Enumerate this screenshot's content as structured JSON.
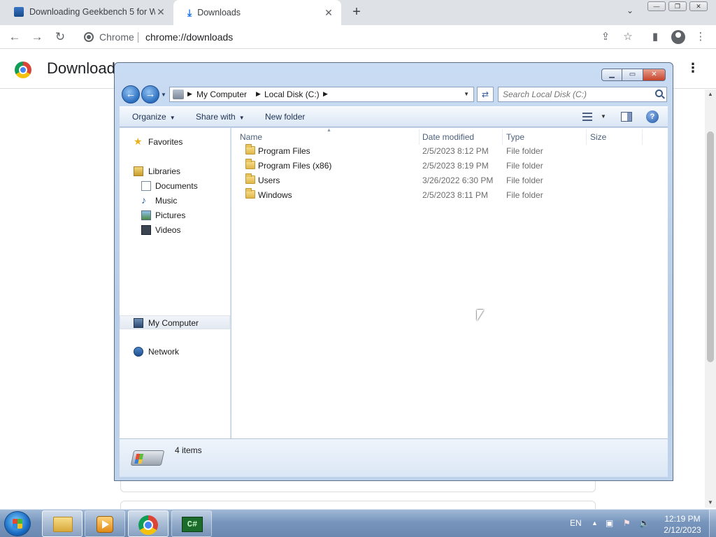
{
  "chrome": {
    "tabs": [
      {
        "title": "Downloading Geekbench 5 for W",
        "close": "✕"
      },
      {
        "title": "Downloads",
        "close": "✕"
      }
    ],
    "new_tab": "+",
    "omnibox": {
      "label": "Chrome",
      "url": "chrome://downloads"
    },
    "page_title": "Download"
  },
  "explorer": {
    "breadcrumbs": [
      "My Computer",
      "Local Disk (C:)"
    ],
    "search_placeholder": "Search Local Disk (C:)",
    "commands": {
      "organize": "Organize",
      "share_with": "Share with",
      "new_folder": "New folder"
    },
    "nav": {
      "favorites": "Favorites",
      "libraries": "Libraries",
      "documents": "Documents",
      "music": "Music",
      "pictures": "Pictures",
      "videos": "Videos",
      "my_computer": "My Computer",
      "network": "Network"
    },
    "columns": {
      "name": "Name",
      "date": "Date modified",
      "type": "Type",
      "size": "Size"
    },
    "files": [
      {
        "name": "Program Files",
        "date": "2/5/2023 8:12 PM",
        "type": "File folder"
      },
      {
        "name": "Program Files (x86)",
        "date": "2/5/2023 8:19 PM",
        "type": "File folder"
      },
      {
        "name": "Users",
        "date": "3/26/2022 6:30 PM",
        "type": "File folder"
      },
      {
        "name": "Windows",
        "date": "2/5/2023 8:11 PM",
        "type": "File folder"
      }
    ],
    "item_count": "4 items"
  },
  "taskbar": {
    "language": "EN",
    "time": "12:19 PM",
    "date": "2/12/2023",
    "csharp_label": "C#"
  }
}
